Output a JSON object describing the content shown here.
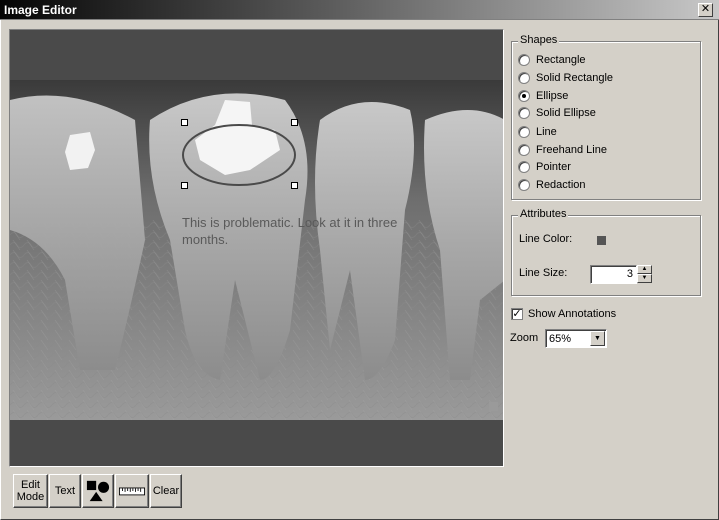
{
  "window": {
    "title": "Image Editor",
    "close_glyph": "✕"
  },
  "canvas": {
    "annotation_text": "This is problematic. Look at it in three months."
  },
  "toolbar": {
    "edit_mode": "Edit\nMode",
    "text": "Text",
    "shapes_icon": "shapes-icon",
    "ruler_icon": "ruler-icon",
    "clear": "Clear"
  },
  "shapes": {
    "label": "Shapes",
    "items": [
      {
        "label": "Rectangle",
        "checked": false
      },
      {
        "label": "Solid Rectangle",
        "checked": false
      },
      {
        "label": "Ellipse",
        "checked": true
      },
      {
        "label": "Solid Ellipse",
        "checked": false
      },
      {
        "label": "Line",
        "checked": false
      },
      {
        "label": "Freehand Line",
        "checked": false
      },
      {
        "label": "Pointer",
        "checked": false
      },
      {
        "label": "Redaction",
        "checked": false
      }
    ]
  },
  "attributes": {
    "label": "Attributes",
    "line_color_label": "Line Color:",
    "line_color": "#555555",
    "line_size_label": "Line Size:",
    "line_size_value": "3"
  },
  "show_annotations": {
    "label": "Show Annotations",
    "checked": true
  },
  "zoom": {
    "label": "Zoom",
    "value": "65%"
  }
}
